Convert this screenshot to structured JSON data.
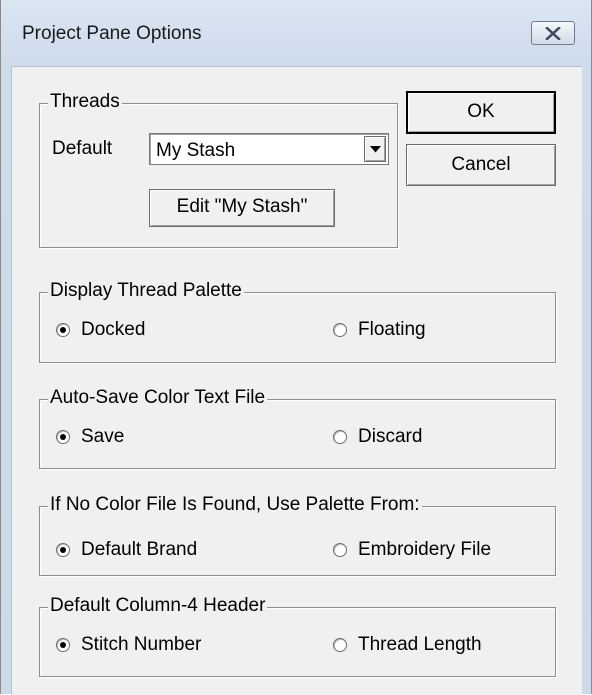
{
  "window": {
    "title": "Project Pane Options",
    "close_icon": "close-x-icon"
  },
  "buttons": {
    "ok": "OK",
    "cancel": "Cancel"
  },
  "threads": {
    "group_label": "Threads",
    "default_label": "Default",
    "combo_value": "My Stash",
    "combo_arrow_icon": "chevron-down-icon",
    "edit_button": "Edit \"My Stash\""
  },
  "groups": [
    {
      "label": "Display Thread Palette",
      "options": [
        {
          "label": "Docked",
          "checked": true
        },
        {
          "label": "Floating",
          "checked": false
        }
      ]
    },
    {
      "label": "Auto-Save Color Text File",
      "options": [
        {
          "label": "Save",
          "checked": true
        },
        {
          "label": "Discard",
          "checked": false
        }
      ]
    },
    {
      "label": "If No Color File Is Found, Use Palette From:",
      "options": [
        {
          "label": "Default Brand",
          "checked": true
        },
        {
          "label": "Embroidery File",
          "checked": false
        }
      ]
    },
    {
      "label": "Default Column-4 Header",
      "options": [
        {
          "label": "Stitch Number",
          "checked": true
        },
        {
          "label": "Thread Length",
          "checked": false
        }
      ]
    }
  ]
}
